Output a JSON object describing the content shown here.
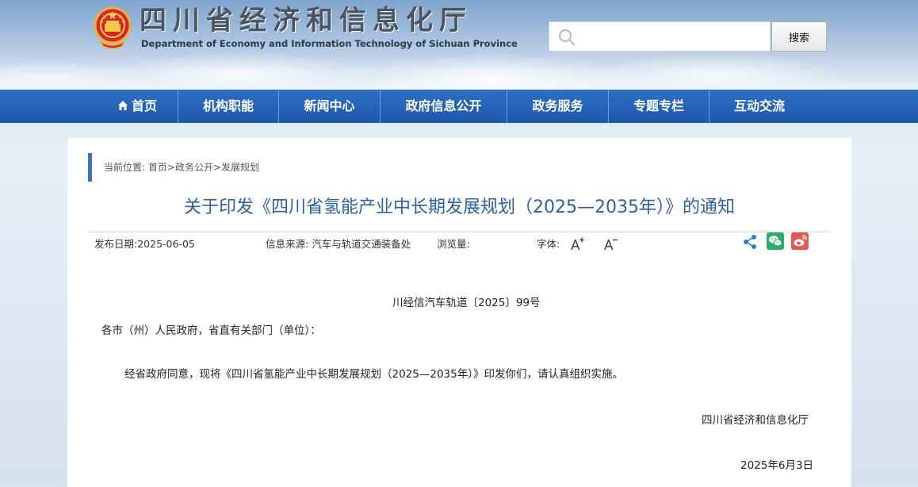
{
  "header": {
    "logo_cn": "四川省经济和信息化厅",
    "logo_en": "Department of Economy and Information Technology of Sichuan Province",
    "search": {
      "placeholder": "",
      "value": "",
      "button_label": "搜索"
    }
  },
  "nav": {
    "items": [
      {
        "label": "首页",
        "icon": "home-icon"
      },
      {
        "label": "机构职能"
      },
      {
        "label": "新闻中心"
      },
      {
        "label": "政府信息公开"
      },
      {
        "label": "政务服务"
      },
      {
        "label": "专题专栏"
      },
      {
        "label": "互动交流"
      }
    ]
  },
  "breadcrumb": {
    "prefix": "当前位置:",
    "items": [
      "首页",
      "政务公开",
      "发展规划"
    ],
    "separator": ">"
  },
  "article": {
    "title": "关于印发《四川省氢能产业中长期发展规划（2025—2035年）》的通知",
    "meta": {
      "date_label": "发布日期:",
      "date": "2025-06-05",
      "source_label": "信息来源:",
      "source": "汽车与轨道交通装备处",
      "views_label": "浏览量:",
      "font_label": "字体:",
      "font_increase": "A⁺",
      "font_decrease": "A⁻"
    },
    "share_icons": [
      "share-icon",
      "wechat-icon",
      "weibo-icon"
    ],
    "doc_number": "川经信汽车轨道〔2025〕99号",
    "salutation": "各市（州）人民政府，省直有关部门（单位）：",
    "body": "经省政府同意，现将《四川省氢能产业中长期发展规划（2025—2035年）》印发你们，请认真组织实施。",
    "signature": "四川省经济和信息化厅",
    "sign_date": "2025年6月3日"
  },
  "colors": {
    "nav_bg": "#1e58ab",
    "title": "#2a5fa8",
    "breadcrumb_bar": "#3b6fb5",
    "wechat": "#2aae67",
    "weibo": "#e6574f"
  }
}
